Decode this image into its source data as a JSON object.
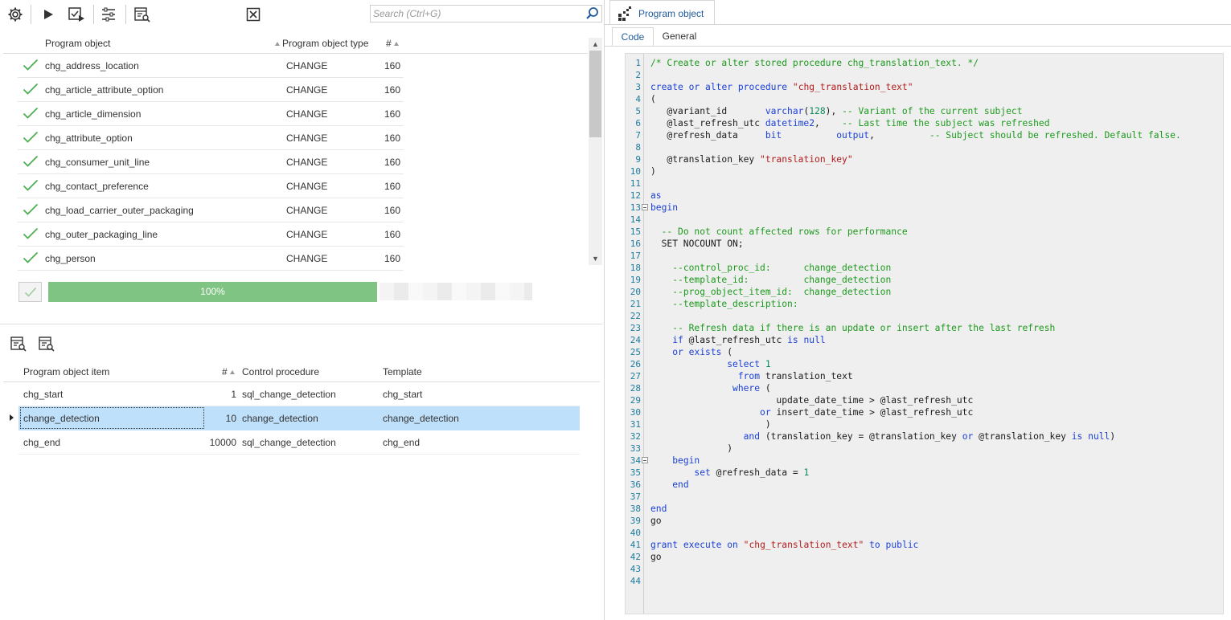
{
  "toolbar": {
    "search_placeholder": "Search (Ctrl+G)"
  },
  "grid1": {
    "headers": {
      "name": "Program object",
      "type": "Program object type",
      "count": "#"
    },
    "rows": [
      {
        "name": "chg_address_location",
        "type": "CHANGE",
        "count": "160"
      },
      {
        "name": "chg_article_attribute_option",
        "type": "CHANGE",
        "count": "160"
      },
      {
        "name": "chg_article_dimension",
        "type": "CHANGE",
        "count": "160"
      },
      {
        "name": "chg_attribute_option",
        "type": "CHANGE",
        "count": "160"
      },
      {
        "name": "chg_consumer_unit_line",
        "type": "CHANGE",
        "count": "160"
      },
      {
        "name": "chg_contact_preference",
        "type": "CHANGE",
        "count": "160"
      },
      {
        "name": "chg_load_carrier_outer_packaging",
        "type": "CHANGE",
        "count": "160"
      },
      {
        "name": "chg_outer_packaging_line",
        "type": "CHANGE",
        "count": "160"
      },
      {
        "name": "chg_person",
        "type": "CHANGE",
        "count": "160"
      }
    ],
    "progress_label": "100%",
    "progress_value": 1.0
  },
  "grid2": {
    "headers": {
      "item": "Program object item",
      "count": "#",
      "proc": "Control procedure",
      "template": "Template"
    },
    "rows": [
      {
        "item": "chg_start",
        "count": "1",
        "proc": "sql_change_detection",
        "template": "chg_start"
      },
      {
        "item": "change_detection",
        "count": "10",
        "proc": "change_detection",
        "template": "change_detection"
      },
      {
        "item": "chg_end",
        "count": "10000",
        "proc": "sql_change_detection",
        "template": "chg_end"
      }
    ]
  },
  "right": {
    "doc_tab": "Program object",
    "subtabs": [
      "Code",
      "General"
    ]
  },
  "code_lines": [
    "/* Create or alter stored procedure chg_translation_text. */",
    "",
    "create or alter procedure \"chg_translation_text\"",
    "(",
    "   @variant_id       varchar(128), -- Variant of the current subject",
    "   @last_refresh_utc datetime2,    -- Last time the subject was refreshed",
    "   @refresh_data     bit          output,          -- Subject should be refreshed. Default false.",
    "",
    "   @translation_key \"translation_key\"",
    ")",
    "",
    "as",
    "begin",
    "",
    "  -- Do not count affected rows for performance",
    "  SET NOCOUNT ON;",
    "",
    "    --control_proc_id:      change_detection",
    "    --template_id:          change_detection",
    "    --prog_object_item_id:  change_detection",
    "    --template_description:",
    "",
    "    -- Refresh data if there is an update or insert after the last refresh",
    "    if @last_refresh_utc is null",
    "    or exists (",
    "              select 1",
    "                from translation_text",
    "               where (",
    "                       update_date_time > @last_refresh_utc",
    "                    or insert_date_time > @last_refresh_utc",
    "                     )",
    "                 and (translation_key = @translation_key or @translation_key is null)",
    "              )",
    "    begin",
    "        set @refresh_data = 1",
    "    end",
    "",
    "end",
    "go",
    "",
    "grant execute on \"chg_translation_text\" to public",
    "go",
    "",
    ""
  ]
}
